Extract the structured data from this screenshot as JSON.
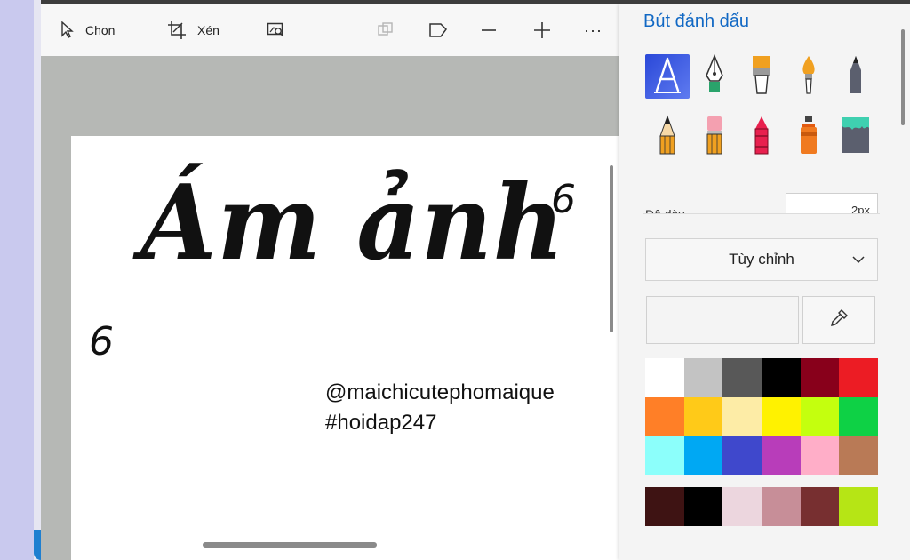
{
  "toolbar": {
    "select_label": "Chọn",
    "crop_label": "Xén",
    "more_label": "···"
  },
  "canvas": {
    "main_text": "Ám ảnh",
    "mark_left": "6",
    "mark_right": "6",
    "signature_line1": "@maichicutephomaique",
    "signature_line2": "#hoidap247"
  },
  "panel": {
    "title": "Bút đánh dấu",
    "tools": [
      {
        "icon": "marker-icon",
        "selected": true
      },
      {
        "icon": "calligraphy-pen-icon"
      },
      {
        "icon": "oil-brush-icon"
      },
      {
        "icon": "watercolor-brush-icon"
      },
      {
        "icon": "pencil-icon"
      },
      {
        "icon": "colored-pencil-icon"
      },
      {
        "icon": "eraser-icon"
      },
      {
        "icon": "crayon-icon"
      },
      {
        "icon": "spray-can-icon"
      },
      {
        "icon": "fill-bucket-icon"
      }
    ],
    "thickness_label": "Độ dày",
    "thickness_value": "2px",
    "dropdown_value": "Tùy chỉnh",
    "colors": [
      "#ffffff",
      "#c3c3c3",
      "#585858",
      "#000000",
      "#88001b",
      "#ec1c24",
      "#ff7f27",
      "#ffca18",
      "#fdeca6",
      "#fff200",
      "#c4ff0e",
      "#0ed145",
      "#8cfffb",
      "#00a8f3",
      "#3f48cc",
      "#b83dba",
      "#ffaec8",
      "#b97a56"
    ],
    "recent_colors": [
      "#3e1313",
      "#000000",
      "#ecd6de",
      "#c78e98",
      "#772f30",
      "#b6e515"
    ]
  },
  "colors": {
    "accent": "#1168c4",
    "selected_tool": "#2a48d8"
  }
}
